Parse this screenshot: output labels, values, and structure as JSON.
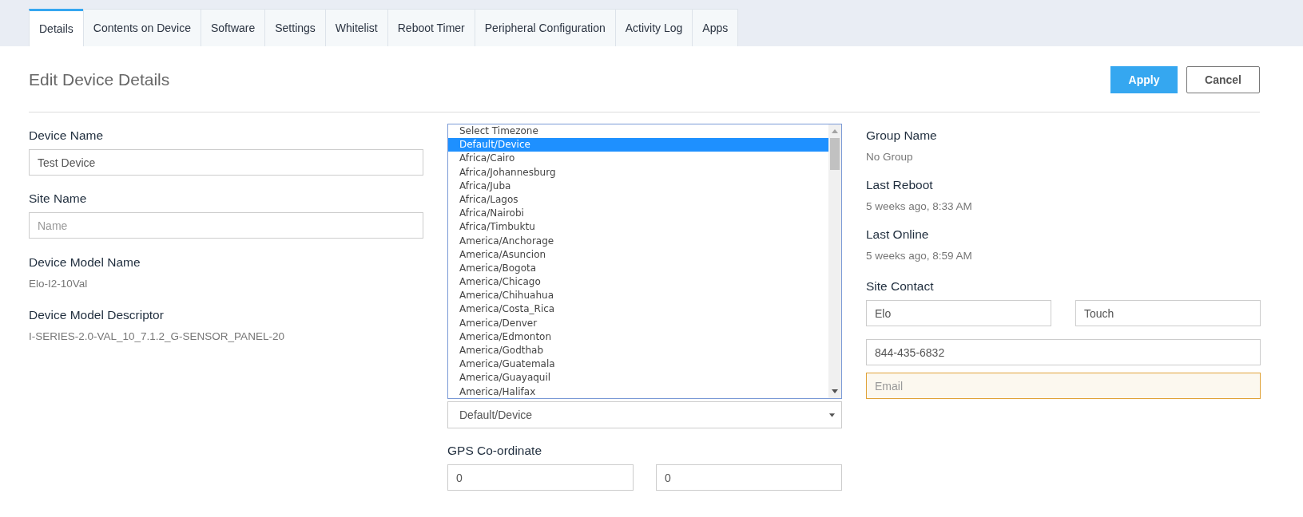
{
  "tabs": [
    {
      "label": "Details",
      "selected": true
    },
    {
      "label": "Contents on Device",
      "selected": false
    },
    {
      "label": "Software",
      "selected": false
    },
    {
      "label": "Settings",
      "selected": false
    },
    {
      "label": "Whitelist",
      "selected": false
    },
    {
      "label": "Reboot Timer",
      "selected": false
    },
    {
      "label": "Peripheral Configuration",
      "selected": false
    },
    {
      "label": "Activity Log",
      "selected": false
    },
    {
      "label": "Apps",
      "selected": false
    }
  ],
  "page_title": "Edit Device Details",
  "buttons": [
    {
      "label": "Apply",
      "kind": "primary"
    },
    {
      "label": "Cancel",
      "kind": "secondary"
    }
  ],
  "left_fields": [
    {
      "kind": "input",
      "label": "Device Name",
      "value": "Test Device"
    },
    {
      "kind": "input",
      "label": "Site Name",
      "placeholder": "Name"
    },
    {
      "kind": "text",
      "label": "Device Model Name",
      "value": "Elo-I2-10Val"
    },
    {
      "kind": "text",
      "label": "Device Model Descriptor",
      "value": "I-SERIES-2.0-VAL_10_7.1.2_G-SENSOR_PANEL-20"
    }
  ],
  "timezone_list": {
    "options": [
      {
        "label": "Select Timezone",
        "selected": false
      },
      {
        "label": "Default/Device",
        "selected": true
      },
      {
        "label": "Africa/Cairo",
        "selected": false
      },
      {
        "label": "Africa/Johannesburg",
        "selected": false
      },
      {
        "label": "Africa/Juba",
        "selected": false
      },
      {
        "label": "Africa/Lagos",
        "selected": false
      },
      {
        "label": "Africa/Nairobi",
        "selected": false
      },
      {
        "label": "Africa/Timbuktu",
        "selected": false
      },
      {
        "label": "America/Anchorage",
        "selected": false
      },
      {
        "label": "America/Asuncion",
        "selected": false
      },
      {
        "label": "America/Bogota",
        "selected": false
      },
      {
        "label": "America/Chicago",
        "selected": false
      },
      {
        "label": "America/Chihuahua",
        "selected": false
      },
      {
        "label": "America/Costa_Rica",
        "selected": false
      },
      {
        "label": "America/Denver",
        "selected": false
      },
      {
        "label": "America/Edmonton",
        "selected": false
      },
      {
        "label": "America/Godthab",
        "selected": false
      },
      {
        "label": "America/Guatemala",
        "selected": false
      },
      {
        "label": "America/Guayaquil",
        "selected": false
      },
      {
        "label": "America/Halifax",
        "selected": false
      }
    ]
  },
  "timezone_select": {
    "value": "Default/Device"
  },
  "gps": {
    "label": "GPS Co-ordinate",
    "values": [
      "0",
      "0"
    ]
  },
  "right_info": [
    {
      "label": "Group Name",
      "value": "No Group"
    },
    {
      "label": "Last Reboot",
      "value": "5 weeks ago, 8:33 AM"
    },
    {
      "label": "Last Online",
      "value": "5 weeks ago, 8:59 AM"
    }
  ],
  "site_contact": {
    "label": "Site Contact",
    "first_name": "Elo",
    "last_name": "Touch",
    "phone": "844-435-6832",
    "email": {
      "placeholder": "Email",
      "highlighted": true
    }
  }
}
